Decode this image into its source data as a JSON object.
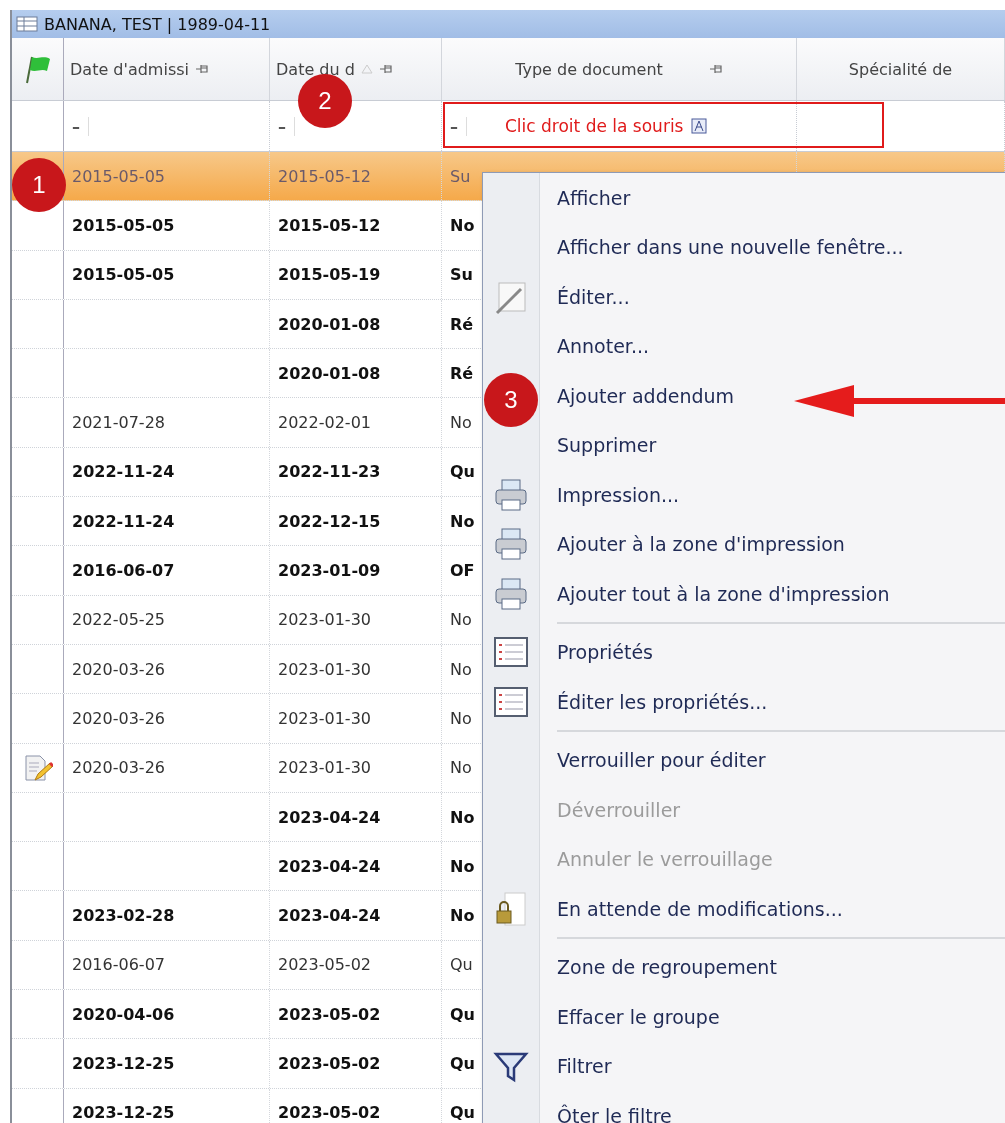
{
  "window": {
    "title": "BANANA, TEST | 1989-04-11"
  },
  "columns": [
    {
      "label": "Date d'admissi",
      "pinned": true,
      "sorted": false
    },
    {
      "label": "Date du d",
      "pinned": true,
      "sorted": true
    },
    {
      "label": "Type de document",
      "pinned": true,
      "sorted": false
    },
    {
      "label": "Spécialité de",
      "pinned": false,
      "sorted": false
    }
  ],
  "filters": [
    "–",
    "–",
    "–"
  ],
  "filter_callout": "Clic droit de la souris",
  "rows": [
    {
      "admission": "2015-05-05",
      "date": "2015-05-12",
      "type": "Su",
      "bold": false,
      "selected": true,
      "has_note": false
    },
    {
      "admission": "2015-05-05",
      "date": "2015-05-12",
      "type": "No",
      "bold": true,
      "selected": false,
      "has_note": false
    },
    {
      "admission": "2015-05-05",
      "date": "2015-05-19",
      "type": "Su",
      "bold": true,
      "selected": false,
      "has_note": false
    },
    {
      "admission": "",
      "date": "2020-01-08",
      "type": "Ré",
      "bold": true,
      "selected": false,
      "has_note": false
    },
    {
      "admission": "",
      "date": "2020-01-08",
      "type": "Ré",
      "bold": true,
      "selected": false,
      "has_note": false
    },
    {
      "admission": "2021-07-28",
      "date": "2022-02-01",
      "type": "No",
      "bold": false,
      "selected": false,
      "has_note": false
    },
    {
      "admission": "2022-11-24",
      "date": "2022-11-23",
      "type": "Qu",
      "bold": true,
      "selected": false,
      "has_note": false
    },
    {
      "admission": "2022-11-24",
      "date": "2022-12-15",
      "type": "No",
      "bold": true,
      "selected": false,
      "has_note": false
    },
    {
      "admission": "2016-06-07",
      "date": "2023-01-09",
      "type": "OF",
      "bold": true,
      "selected": false,
      "has_note": false
    },
    {
      "admission": "2022-05-25",
      "date": "2023-01-30",
      "type": "No",
      "bold": false,
      "selected": false,
      "has_note": false
    },
    {
      "admission": "2020-03-26",
      "date": "2023-01-30",
      "type": "No",
      "bold": false,
      "selected": false,
      "has_note": false
    },
    {
      "admission": "2020-03-26",
      "date": "2023-01-30",
      "type": "No",
      "bold": false,
      "selected": false,
      "has_note": false
    },
    {
      "admission": "2020-03-26",
      "date": "2023-01-30",
      "type": "No",
      "bold": false,
      "selected": false,
      "has_note": true
    },
    {
      "admission": "",
      "date": "2023-04-24",
      "type": "No",
      "bold": true,
      "selected": false,
      "has_note": false
    },
    {
      "admission": "",
      "date": "2023-04-24",
      "type": "No",
      "bold": true,
      "selected": false,
      "has_note": false
    },
    {
      "admission": "2023-02-28",
      "date": "2023-04-24",
      "type": "No",
      "bold": true,
      "selected": false,
      "has_note": false
    },
    {
      "admission": "2016-06-07",
      "date": "2023-05-02",
      "type": "Qu",
      "bold": false,
      "selected": false,
      "has_note": false
    },
    {
      "admission": "2020-04-06",
      "date": "2023-05-02",
      "type": "Qu",
      "bold": true,
      "selected": false,
      "has_note": false
    },
    {
      "admission": "2023-12-25",
      "date": "2023-05-02",
      "type": "Qu",
      "bold": true,
      "selected": false,
      "has_note": false
    },
    {
      "admission": "2023-12-25",
      "date": "2023-05-02",
      "type": "Qu",
      "bold": true,
      "selected": false,
      "has_note": false
    }
  ],
  "context_menu": [
    {
      "kind": "plain",
      "label": "Afficher",
      "disabled": false
    },
    {
      "kind": "plain",
      "label": "Afficher dans une nouvelle fenêtre...",
      "disabled": false
    },
    {
      "kind": "edit",
      "label": "Éditer...",
      "disabled": false
    },
    {
      "kind": "plain",
      "label": "Annoter...",
      "disabled": false
    },
    {
      "kind": "plain",
      "label": "Ajouter addendum",
      "disabled": false
    },
    {
      "kind": "plain",
      "label": "Supprimer",
      "disabled": false
    },
    {
      "kind": "print",
      "label": "Impression...",
      "disabled": false
    },
    {
      "kind": "print",
      "label": "Ajouter à la zone d'impression",
      "disabled": false
    },
    {
      "kind": "print",
      "label": "Ajouter tout à la zone d'impression",
      "disabled": false
    },
    {
      "kind": "separator"
    },
    {
      "kind": "properties",
      "label": "Propriétés",
      "disabled": false
    },
    {
      "kind": "properties",
      "label": "Éditer les propriétés...",
      "disabled": false
    },
    {
      "kind": "separator"
    },
    {
      "kind": "plain",
      "label": "Verrouiller pour éditer",
      "disabled": false
    },
    {
      "kind": "plain",
      "label": "Déverrouiller",
      "disabled": true
    },
    {
      "kind": "plain",
      "label": "Annuler le verrouillage",
      "disabled": true
    },
    {
      "kind": "lock",
      "label": "En attende de modifications...",
      "disabled": false
    },
    {
      "kind": "separator"
    },
    {
      "kind": "plain",
      "label": "Zone de regroupement",
      "disabled": false
    },
    {
      "kind": "plain",
      "label": "Effacer le groupe",
      "disabled": false
    },
    {
      "kind": "filter",
      "label": "Filtrer",
      "disabled": false
    },
    {
      "kind": "plain",
      "label": "Ôter le filtre",
      "disabled": false
    }
  ],
  "markers": [
    "1",
    "2",
    "3"
  ]
}
